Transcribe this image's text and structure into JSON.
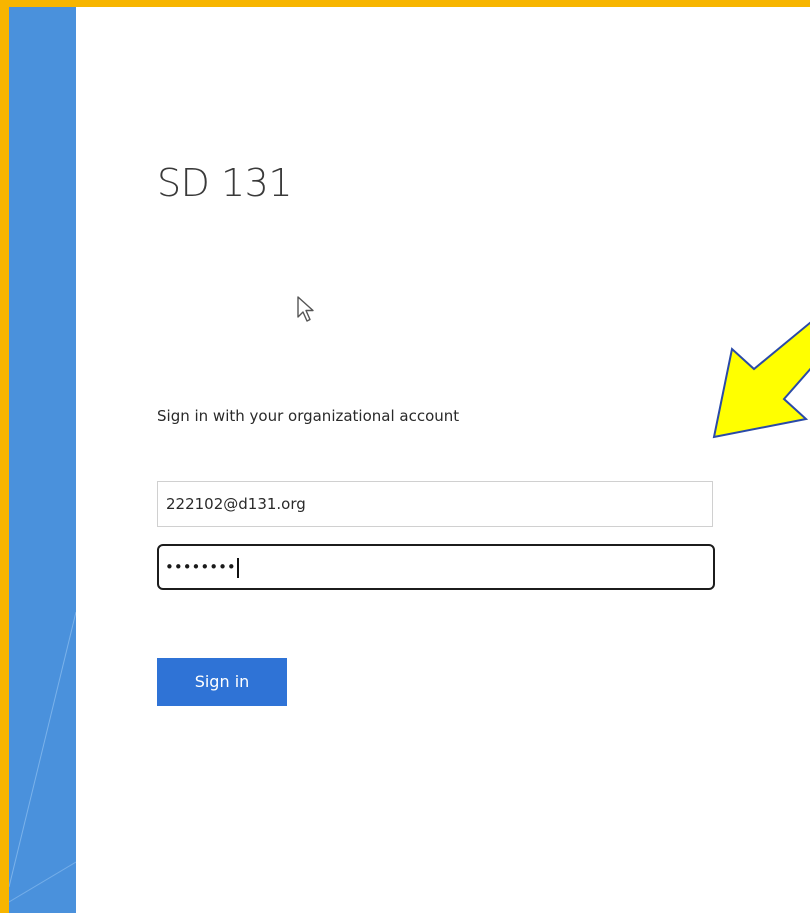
{
  "page": {
    "org_title": "SD 131",
    "instruction": "Sign in with your organizational account",
    "username_value": "222102@d131.org",
    "password_mask": "••••••••",
    "signin_label": "Sign in"
  },
  "colors": {
    "frame_border": "#f7b500",
    "side_panel": "#4a91dc",
    "button": "#2f73d6",
    "annotation_arrow_fill": "#ffff00",
    "annotation_arrow_stroke": "#2a4aa8"
  },
  "icons": {
    "cursor": "mouse-pointer-icon",
    "annotation": "yellow-arrow-icon"
  }
}
